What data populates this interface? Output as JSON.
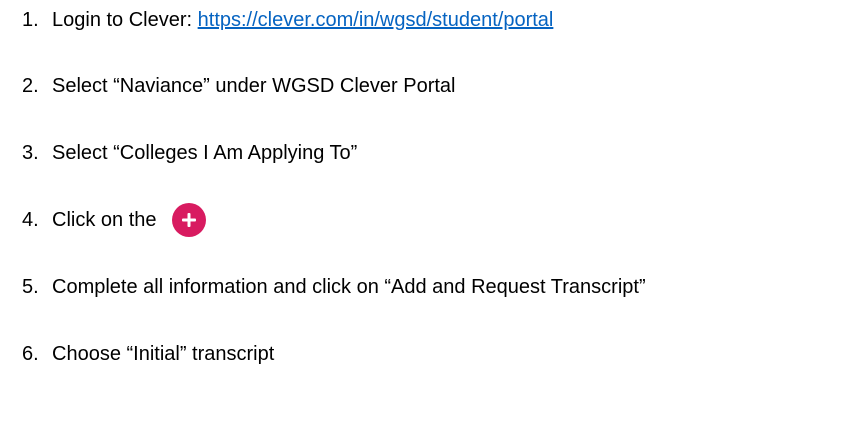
{
  "steps": [
    {
      "num": "1.",
      "text": "Login to Clever: ",
      "link": "https://clever.com/in/wgsd/student/portal"
    },
    {
      "num": "2.",
      "text": "Select “Naviance” under WGSD Clever Portal"
    },
    {
      "num": "3.",
      "text": "Select “Colleges I Am Applying To”"
    },
    {
      "num": "4.",
      "text": "Click on the",
      "button_icon": "plus-icon",
      "button_color": "#D81B60"
    },
    {
      "num": "5.",
      "text": "Complete all information and click on “Add and Request Transcript”"
    },
    {
      "num": "6.",
      "text": "Choose “Initial” transcript"
    }
  ],
  "colors": {
    "link": "#0563C1",
    "add_button": "#D81B60",
    "text": "#000000"
  }
}
